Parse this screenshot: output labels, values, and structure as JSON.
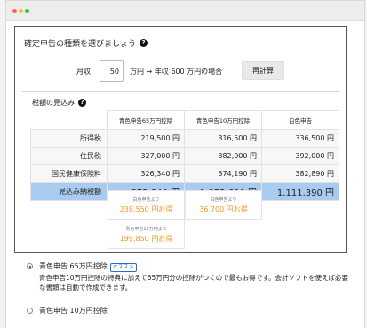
{
  "heading": "確定申告の種類を選びましょう",
  "income": {
    "label": "月収",
    "value": "50",
    "text": "万円 → 年収 600 万円の場合",
    "recalc_label": "再計算"
  },
  "tax_section_title": "税額の見込み",
  "table": {
    "columns": [
      "青色申告65万円控除",
      "青色申告10万円控除",
      "白色申告"
    ],
    "rows": [
      {
        "label": "所得税",
        "values": [
          "219,500 円",
          "316,500 円",
          "336,500 円"
        ]
      },
      {
        "label": "住民税",
        "values": [
          "327,000 円",
          "382,000 円",
          "392,000 円"
        ]
      },
      {
        "label": "国民健康保険料",
        "values": [
          "326,340 円",
          "374,190 円",
          "382,890 円"
        ]
      }
    ],
    "total": {
      "label": "見込み納税額",
      "values": [
        "872,840 円",
        "1,072,690 円",
        "1,111,390 円"
      ]
    }
  },
  "savings": [
    {
      "caption": "白色申告より",
      "amount": "238,550 円お得"
    },
    {
      "caption": "白色申告より",
      "amount": "36,700 円お得"
    },
    {
      "caption": "青色申告10万円より",
      "amount": "199,850 円お得"
    }
  ],
  "options": [
    {
      "title": "青色申告 65万円控除",
      "badge": "オススメ",
      "selected": true,
      "description": "青色申告10万円控除の特典に加えて65万円分の控除がつくので最もお得です。会計ソフトを使えば必要な書類は自動で作成できます。"
    },
    {
      "title": "青色申告 10万円控除",
      "selected": false
    }
  ],
  "colors": {
    "highlight_row": "#aacbf0",
    "savings_text": "#f39a28",
    "badge": "#2a6ec7"
  }
}
